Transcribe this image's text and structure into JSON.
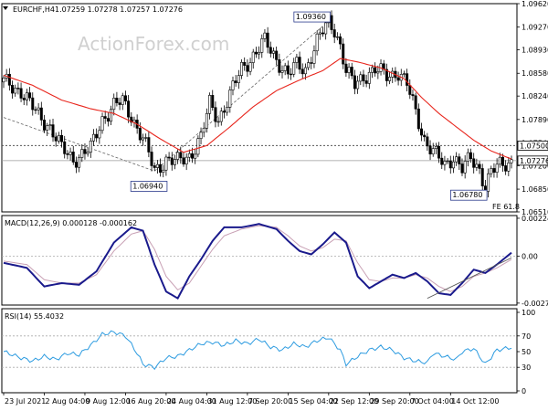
{
  "header": {
    "symbol": "EURCHF,H4",
    "ohlc": "1.07259 1.07278 1.07257 1.07276"
  },
  "watermark": "ActionForex.com",
  "colors": {
    "candle": "#000000",
    "ma": "#e8261d",
    "macd_main": "#1a1a8c",
    "macd_signal": "#c8a0b4",
    "rsi": "#2c9be0",
    "trendline": "#555555",
    "dotted": "#999999",
    "tag_border": "#2a3a8c"
  },
  "chart_data": [
    {
      "type": "candlestick",
      "panel": "price",
      "ylim": [
        1.0651,
        1.0962
      ],
      "y_ticks": [
        "1.09620",
        "1.09270",
        "1.08930",
        "1.08580",
        "1.08240",
        "1.07890",
        "1.07540",
        "1.07200",
        "1.06850",
        "1.06510"
      ],
      "y_tick_values": [
        1.0962,
        1.0927,
        1.0893,
        1.0858,
        1.0824,
        1.0789,
        1.0754,
        1.072,
        1.0685,
        1.0651
      ],
      "anchors": [
        [
          0,
          1.0845
        ],
        [
          6,
          1.0832
        ],
        [
          11,
          1.08
        ],
        [
          16,
          1.0778
        ],
        [
          20,
          1.0745
        ],
        [
          24,
          1.073
        ],
        [
          30,
          1.0745
        ],
        [
          34,
          1.079
        ],
        [
          38,
          1.081
        ],
        [
          41,
          1.0815
        ],
        [
          44,
          1.0795
        ],
        [
          48,
          1.076
        ],
        [
          52,
          1.0712
        ],
        [
          56,
          1.073
        ],
        [
          60,
          1.0725
        ],
        [
          64,
          1.0735
        ],
        [
          68,
          1.0762
        ],
        [
          71,
          1.0812
        ],
        [
          74,
          1.079
        ],
        [
          78,
          1.0825
        ],
        [
          82,
          1.0865
        ],
        [
          86,
          1.0885
        ],
        [
          90,
          1.0905
        ],
        [
          94,
          1.088
        ],
        [
          98,
          1.0855
        ],
        [
          101,
          1.087
        ],
        [
          104,
          1.0865
        ],
        [
          108,
          1.0905
        ],
        [
          112,
          1.0935
        ],
        [
          114,
          1.0925
        ],
        [
          116,
          1.09
        ],
        [
          118,
          1.086
        ],
        [
          121,
          1.084
        ],
        [
          124,
          1.0855
        ],
        [
          128,
          1.0862
        ],
        [
          132,
          1.0855
        ],
        [
          136,
          1.086
        ],
        [
          139,
          1.084
        ],
        [
          142,
          1.08
        ],
        [
          145,
          1.076
        ],
        [
          148,
          1.074
        ],
        [
          152,
          1.072
        ],
        [
          155,
          1.0735
        ],
        [
          158,
          1.0715
        ],
        [
          161,
          1.073
        ],
        [
          164,
          1.0715
        ],
        [
          166,
          1.069
        ],
        [
          168,
          1.071
        ],
        [
          171,
          1.072
        ],
        [
          175,
          1.07276
        ]
      ],
      "moving_average": [
        [
          0,
          1.0855
        ],
        [
          10,
          1.084
        ],
        [
          20,
          1.0818
        ],
        [
          30,
          1.0805
        ],
        [
          38,
          1.0798
        ],
        [
          46,
          1.0782
        ],
        [
          54,
          1.076
        ],
        [
          62,
          1.074
        ],
        [
          70,
          1.075
        ],
        [
          78,
          1.0778
        ],
        [
          86,
          1.0808
        ],
        [
          94,
          1.0832
        ],
        [
          102,
          1.0848
        ],
        [
          110,
          1.0862
        ],
        [
          116,
          1.088
        ],
        [
          122,
          1.0875
        ],
        [
          130,
          1.0866
        ],
        [
          138,
          1.085
        ],
        [
          144,
          1.0822
        ],
        [
          150,
          1.0798
        ],
        [
          156,
          1.0778
        ],
        [
          162,
          1.0758
        ],
        [
          168,
          1.0742
        ],
        [
          175,
          1.073
        ]
      ],
      "price_labels": [
        "1.09360",
        "1.06940",
        "1.06780"
      ],
      "right_tags": [
        "1.07500",
        "1.07276"
      ],
      "level_1_0750": 1.075,
      "current": 1.07276,
      "annotation": "FE 61.8"
    },
    {
      "type": "line",
      "panel": "macd",
      "title": "MACD(12,26,9) 0.000128 -0.000162",
      "ylim": [
        -0.0029,
        0.0024
      ],
      "y_ticks": [
        "0.00224",
        "0.00",
        "-0.002785"
      ],
      "y_tick_values": [
        0.00224,
        0.0,
        -0.002785
      ],
      "series": [
        {
          "name": "main",
          "anchors": [
            [
              0,
              -0.0004
            ],
            [
              8,
              -0.0007
            ],
            [
              14,
              -0.0018
            ],
            [
              20,
              -0.0016
            ],
            [
              26,
              -0.0017
            ],
            [
              32,
              -0.0009
            ],
            [
              38,
              0.0008
            ],
            [
              44,
              0.0017
            ],
            [
              48,
              0.0015
            ],
            [
              52,
              -0.0005
            ],
            [
              56,
              -0.0021
            ],
            [
              60,
              -0.0025
            ],
            [
              64,
              -0.0012
            ],
            [
              68,
              -0.0002
            ],
            [
              72,
              0.0009
            ],
            [
              76,
              0.0017
            ],
            [
              82,
              0.0017
            ],
            [
              88,
              0.0019
            ],
            [
              94,
              0.0016
            ],
            [
              98,
              0.0009
            ],
            [
              102,
              0.0003
            ],
            [
              106,
              0.0001
            ],
            [
              110,
              0.0007
            ],
            [
              114,
              0.0014
            ],
            [
              118,
              0.0008
            ],
            [
              122,
              -0.0012
            ],
            [
              126,
              -0.0019
            ],
            [
              130,
              -0.0015
            ],
            [
              134,
              -0.0011
            ],
            [
              138,
              -0.0013
            ],
            [
              142,
              -0.001
            ],
            [
              146,
              -0.0015
            ],
            [
              150,
              -0.0022
            ],
            [
              154,
              -0.0023
            ],
            [
              158,
              -0.0016
            ],
            [
              162,
              -0.0008
            ],
            [
              166,
              -0.001
            ],
            [
              170,
              -0.0005
            ],
            [
              175,
              0.0002
            ]
          ]
        },
        {
          "name": "signal",
          "anchors": [
            [
              0,
              -0.0003
            ],
            [
              8,
              -0.0005
            ],
            [
              14,
              -0.0014
            ],
            [
              20,
              -0.0016
            ],
            [
              26,
              -0.0016
            ],
            [
              32,
              -0.0011
            ],
            [
              38,
              0.0003
            ],
            [
              44,
              0.0013
            ],
            [
              48,
              0.0015
            ],
            [
              52,
              0.0004
            ],
            [
              56,
              -0.0012
            ],
            [
              60,
              -0.002
            ],
            [
              64,
              -0.0016
            ],
            [
              68,
              -0.0006
            ],
            [
              72,
              0.0004
            ],
            [
              76,
              0.0012
            ],
            [
              82,
              0.0016
            ],
            [
              88,
              0.0018
            ],
            [
              94,
              0.0017
            ],
            [
              98,
              0.0012
            ],
            [
              102,
              0.0006
            ],
            [
              106,
              0.0003
            ],
            [
              110,
              0.0005
            ],
            [
              114,
              0.001
            ],
            [
              118,
              0.0009
            ],
            [
              122,
              -0.0004
            ],
            [
              126,
              -0.0014
            ],
            [
              130,
              -0.0015
            ],
            [
              134,
              -0.0013
            ],
            [
              138,
              -0.0013
            ],
            [
              142,
              -0.0011
            ],
            [
              146,
              -0.0013
            ],
            [
              150,
              -0.0018
            ],
            [
              154,
              -0.0021
            ],
            [
              158,
              -0.0018
            ],
            [
              162,
              -0.0012
            ],
            [
              166,
              -0.001
            ],
            [
              170,
              -0.0007
            ],
            [
              175,
              -0.0002
            ]
          ]
        }
      ],
      "trendline": [
        [
          146,
          -0.0025
        ],
        [
          175,
          -0.0001
        ]
      ]
    },
    {
      "type": "line",
      "panel": "rsi",
      "title": "RSI(14) 55.4032",
      "ylim": [
        0,
        100
      ],
      "y_ticks": [
        "100",
        "70",
        "50",
        "30",
        "0"
      ],
      "y_tick_values": [
        100,
        70,
        50,
        30,
        0
      ],
      "levels": [
        70,
        30
      ],
      "series": [
        {
          "name": "RSI",
          "anchors": [
            [
              0,
              50
            ],
            [
              6,
              42
            ],
            [
              10,
              38
            ],
            [
              14,
              44
            ],
            [
              18,
              40
            ],
            [
              22,
              48
            ],
            [
              26,
              46
            ],
            [
              30,
              58
            ],
            [
              34,
              72
            ],
            [
              38,
              75
            ],
            [
              42,
              70
            ],
            [
              46,
              48
            ],
            [
              48,
              34
            ],
            [
              52,
              30
            ],
            [
              56,
              42
            ],
            [
              60,
              44
            ],
            [
              64,
              52
            ],
            [
              68,
              60
            ],
            [
              72,
              62
            ],
            [
              76,
              58
            ],
            [
              80,
              64
            ],
            [
              84,
              60
            ],
            [
              88,
              66
            ],
            [
              92,
              56
            ],
            [
              96,
              52
            ],
            [
              100,
              60
            ],
            [
              104,
              56
            ],
            [
              108,
              64
            ],
            [
              112,
              68
            ],
            [
              116,
              52
            ],
            [
              118,
              34
            ],
            [
              122,
              44
            ],
            [
              126,
              52
            ],
            [
              130,
              56
            ],
            [
              134,
              52
            ],
            [
              138,
              42
            ],
            [
              142,
              38
            ],
            [
              146,
              36
            ],
            [
              148,
              48
            ],
            [
              152,
              44
            ],
            [
              156,
              40
            ],
            [
              158,
              50
            ],
            [
              162,
              54
            ],
            [
              166,
              34
            ],
            [
              170,
              52
            ],
            [
              175,
              55.4
            ]
          ]
        }
      ]
    }
  ],
  "x_axis_labels": [
    "23 Jul 2021",
    "2 Aug 04:00",
    "9 Aug 12:00",
    "16 Aug 20:00",
    "24 Aug 04:00",
    "31 Aug 12:00",
    "7 Sep 20:00",
    "15 Sep 04:00",
    "22 Sep 12:00",
    "29 Sep 20:00",
    "7 Oct 04:00",
    "14 Oct 12:00"
  ],
  "x_axis_bars": [
    0,
    14,
    28,
    42,
    56,
    70,
    84,
    98,
    112,
    126,
    140,
    154
  ],
  "bar_count": 176
}
